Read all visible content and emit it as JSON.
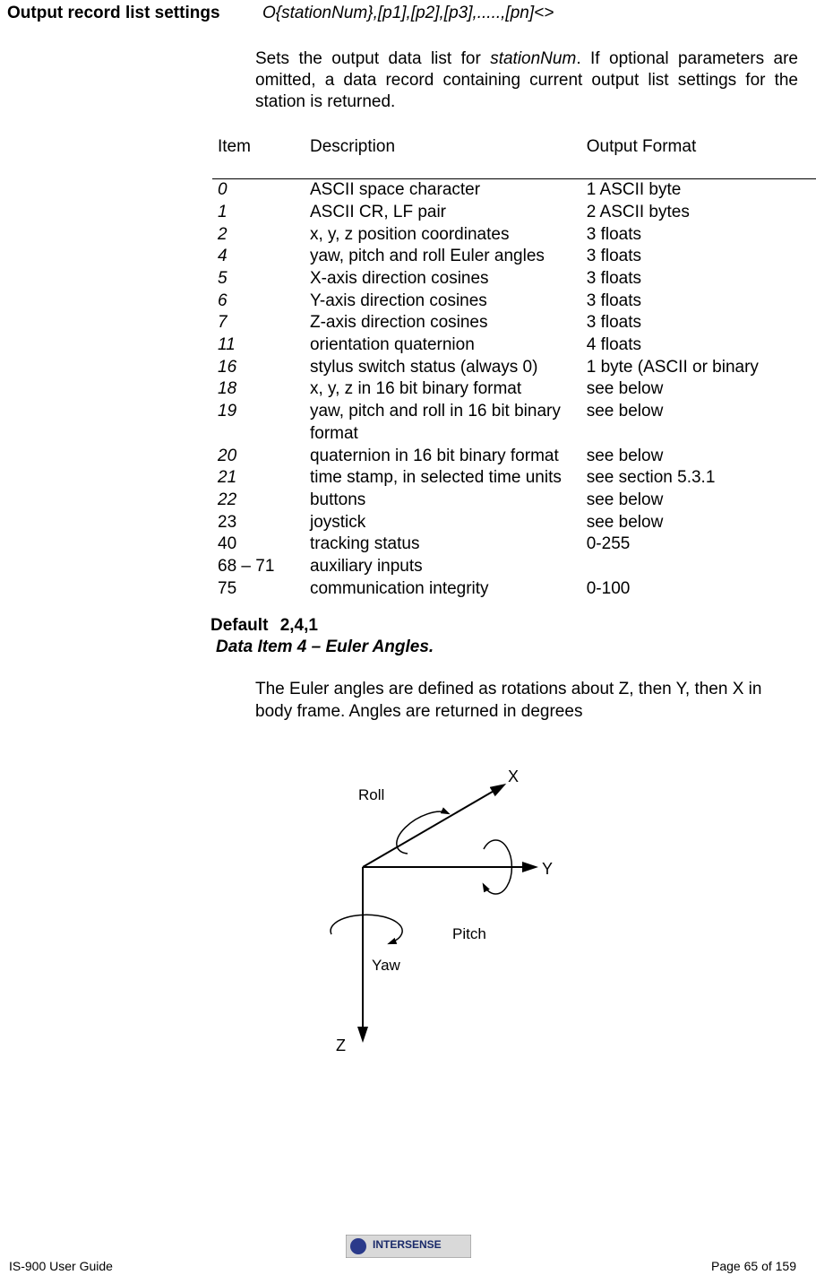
{
  "heading": {
    "left": "Output record list settings",
    "command": "O{stationNum},[p1],[p2],[p3],.....,[pn]<>"
  },
  "description": {
    "part1": "Sets the output data list for ",
    "station": "stationNum",
    "part2": ".  If optional parameters are omitted, a data record containing current output list settings for the station is returned."
  },
  "table": {
    "headers": {
      "item": "Item",
      "desc": "Description",
      "fmt": "Output Format"
    },
    "rows": [
      {
        "item": "0",
        "italic": true,
        "desc": "ASCII space character",
        "fmt": "1 ASCII byte"
      },
      {
        "item": "1",
        "italic": true,
        "desc": "ASCII CR, LF pair",
        "fmt": "2 ASCII bytes"
      },
      {
        "item": "2",
        "italic": true,
        "desc": "x, y, z position coordinates",
        "fmt": "3 floats"
      },
      {
        "item": "4",
        "italic": true,
        "desc": "yaw, pitch and roll Euler angles",
        "fmt": "3 floats"
      },
      {
        "item": "5",
        "italic": true,
        "desc": "X-axis direction cosines",
        "fmt": "3 floats"
      },
      {
        "item": "6",
        "italic": true,
        "desc": "Y-axis direction cosines",
        "fmt": "3 floats"
      },
      {
        "item": "7",
        "italic": true,
        "desc": "Z-axis direction cosines",
        "fmt": "3 floats"
      },
      {
        "item": "11",
        "italic": true,
        "desc": "orientation quaternion",
        "fmt": "4 floats"
      },
      {
        "item": "16",
        "italic": true,
        "desc": "stylus switch status (always 0)",
        "fmt": "1 byte (ASCII or binary"
      },
      {
        "item": "18",
        "italic": true,
        "desc": "x, y, z in 16 bit binary format",
        "fmt": "see below"
      },
      {
        "item": "19",
        "italic": true,
        "desc": "yaw, pitch and roll in 16 bit binary format",
        "fmt": "see below"
      },
      {
        "item": "20",
        "italic": true,
        "desc": "quaternion in 16 bit binary format",
        "fmt": "see below"
      },
      {
        "item": "21",
        "italic": true,
        "desc": "time stamp, in selected time units",
        "fmt": "see section 5.3.1"
      },
      {
        "item": "22",
        "italic": true,
        "desc": "buttons",
        "fmt": "see below"
      },
      {
        "item": "23",
        "italic": false,
        "desc": "joystick",
        "fmt": "see below"
      },
      {
        "item": "40",
        "italic": false,
        "desc": "tracking status",
        "fmt": "0-255"
      },
      {
        "item": "68 – 71",
        "italic": false,
        "desc": "auxiliary inputs",
        "fmt": ""
      },
      {
        "item": "75",
        "italic": false,
        "desc": "communication integrity",
        "fmt": "0-100"
      }
    ]
  },
  "default_label": "Default",
  "default_value": "2,4,1",
  "data_item_title": "Data Item 4 – Euler Angles.",
  "euler_desc": "The Euler angles are defined as rotations about Z, then Y, then X in body frame.  Angles are returned in degrees",
  "diagram": {
    "x_label": "X",
    "y_label": "Y",
    "z_label": "Z",
    "roll_label": "Roll",
    "pitch_label": "Pitch",
    "yaw_label": "Yaw"
  },
  "footer": {
    "left": "IS-900 User Guide",
    "right": "Page 65 of 159",
    "logo_text": "INTERSENSE"
  }
}
